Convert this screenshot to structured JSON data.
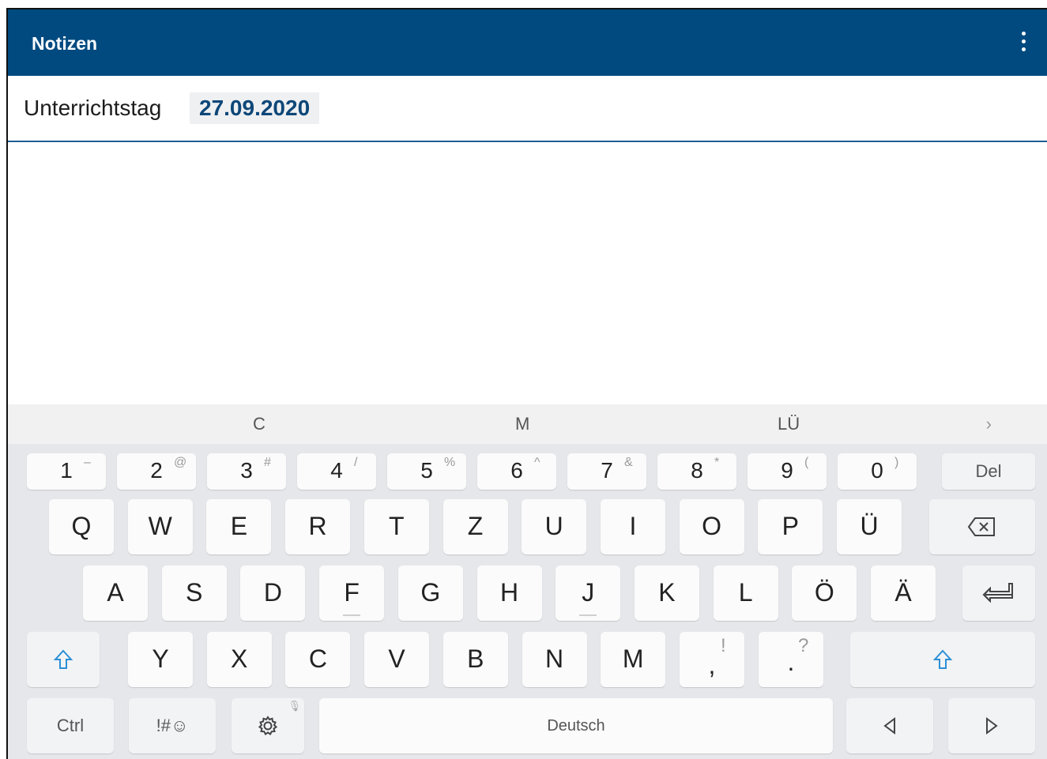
{
  "app": {
    "title": "Notizen"
  },
  "day": {
    "label": "Unterrichtstag",
    "date": "27.09.2020"
  },
  "keyboard": {
    "suggestions": [
      "C",
      "M",
      "LÜ"
    ],
    "number_row": [
      {
        "main": "1",
        "sub": "–"
      },
      {
        "main": "2",
        "sub": "@"
      },
      {
        "main": "3",
        "sub": "#"
      },
      {
        "main": "4",
        "sub": "/"
      },
      {
        "main": "5",
        "sub": "%"
      },
      {
        "main": "6",
        "sub": "^"
      },
      {
        "main": "7",
        "sub": "&"
      },
      {
        "main": "8",
        "sub": "*"
      },
      {
        "main": "9",
        "sub": "("
      },
      {
        "main": "0",
        "sub": ")"
      }
    ],
    "del_label": "Del",
    "row1": [
      "Q",
      "W",
      "E",
      "R",
      "T",
      "Z",
      "U",
      "I",
      "O",
      "P",
      "Ü"
    ],
    "row2": [
      "A",
      "S",
      "D",
      "F",
      "G",
      "H",
      "J",
      "K",
      "L",
      "Ö",
      "Ä"
    ],
    "row3": [
      "Y",
      "X",
      "C",
      "V",
      "B",
      "N",
      "M"
    ],
    "comma": {
      "main": ",",
      "sub": "!"
    },
    "period": {
      "main": ".",
      "sub": "?"
    },
    "ctrl_label": "Ctrl",
    "symbols_label": "!#☺",
    "space_label": "Deutsch"
  }
}
